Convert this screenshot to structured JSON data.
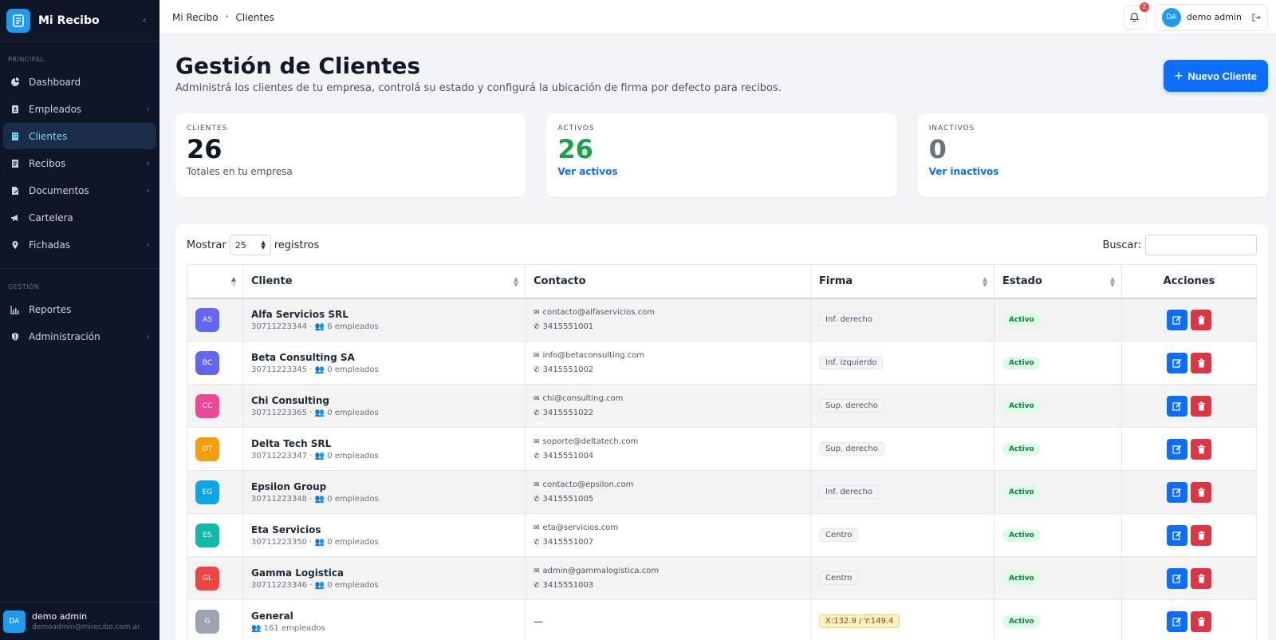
{
  "app": {
    "name": "Mi Recibo"
  },
  "sidebar": {
    "section_principal": "PRINCIPAL",
    "section_gestion": "GESTIÓN",
    "items_principal": [
      {
        "label": "Dashboard",
        "icon": "dashboard-icon"
      },
      {
        "label": "Empleados",
        "icon": "id-card-icon",
        "has_children": true
      },
      {
        "label": "Clientes",
        "icon": "building-icon",
        "active": true
      },
      {
        "label": "Recibos",
        "icon": "receipt-icon",
        "has_children": true
      },
      {
        "label": "Documentos",
        "icon": "document-icon",
        "has_children": true
      },
      {
        "label": "Cartelera",
        "icon": "megaphone-icon"
      },
      {
        "label": "Fichadas",
        "icon": "location-pin-icon",
        "has_children": true
      }
    ],
    "items_gestion": [
      {
        "label": "Reportes",
        "icon": "chart-icon"
      },
      {
        "label": "Administración",
        "icon": "shield-icon",
        "has_children": true
      }
    ],
    "user": {
      "initials": "DA",
      "name": "demo admin",
      "email": "demoadmin@mirecibo.com.ar"
    }
  },
  "topbar": {
    "breadcrumb": [
      "Mi Recibo",
      "Clientes"
    ],
    "notifications_count": "2",
    "user_initials": "DA",
    "user_name": "demo admin"
  },
  "page": {
    "title": "Gestión de Clientes",
    "subtitle": "Administrá los clientes de tu empresa, controlá su estado y configurá la ubicación de firma por defecto para recibos.",
    "new_button": "Nuevo Cliente"
  },
  "stats": {
    "clientes": {
      "label": "CLIENTES",
      "value": "26",
      "note": "Totales en tu empresa"
    },
    "activos": {
      "label": "ACTIVOS",
      "value": "26",
      "link": "Ver activos"
    },
    "inactivos": {
      "label": "INACTIVOS",
      "value": "0",
      "link": "Ver inactivos"
    }
  },
  "table": {
    "show_label": "Mostrar",
    "page_size": "25",
    "records_label": "registros",
    "search_label": "Buscar:",
    "search_value": "",
    "columns": [
      "",
      "Cliente",
      "Contacto",
      "Firma",
      "Estado",
      "Acciones"
    ],
    "rows": [
      {
        "initials": "AS",
        "color": "#6366f1",
        "name": "Alfa Servicios SRL",
        "cuit": "30711223344",
        "employees": "6 empleados",
        "email": "contacto@alfaservicios.com",
        "phone": "3415551001",
        "firma": "Inf. derecho",
        "estado": "Activo"
      },
      {
        "initials": "BC",
        "color": "#6366f1",
        "name": "Beta Consulting SA",
        "cuit": "30711223345",
        "employees": "0 empleados",
        "email": "info@betaconsulting.com",
        "phone": "3415551002",
        "firma": "Inf. izquierdo",
        "estado": "Activo"
      },
      {
        "initials": "CC",
        "color": "#ec4899",
        "name": "Chi Consulting",
        "cuit": "30711223365",
        "employees": "0 empleados",
        "email": "chi@consulting.com",
        "phone": "3415551022",
        "firma": "Sup. derecho",
        "estado": "Activo"
      },
      {
        "initials": "DT",
        "color": "#f59e0b",
        "name": "Delta Tech SRL",
        "cuit": "30711223347",
        "employees": "0 empleados",
        "email": "soporte@deltatech.com",
        "phone": "3415551004",
        "firma": "Sup. derecho",
        "estado": "Activo"
      },
      {
        "initials": "EG",
        "color": "#0ea5e9",
        "name": "Epsilon Group",
        "cuit": "30711223348",
        "employees": "0 empleados",
        "email": "contacto@epsilon.com",
        "phone": "3415551005",
        "firma": "Inf. derecho",
        "estado": "Activo"
      },
      {
        "initials": "ES",
        "color": "#14b8a6",
        "name": "Eta Servicios",
        "cuit": "30711223350",
        "employees": "0 empleados",
        "email": "eta@servicios.com",
        "phone": "3415551007",
        "firma": "Centro",
        "estado": "Activo"
      },
      {
        "initials": "GL",
        "color": "#ef4444",
        "name": "Gamma Logistica",
        "cuit": "30711223346",
        "employees": "0 empleados",
        "email": "admin@gammalogistica.com",
        "phone": "3415551003",
        "firma": "Centro",
        "estado": "Activo"
      },
      {
        "initials": "G",
        "color": "#9ca3af",
        "name": "General",
        "cuit": "",
        "employees": "161 empleados",
        "email": "",
        "phone": "",
        "no_contact": "—",
        "firma": "X:132.9 / Y:149.4",
        "firma_warn": true,
        "estado": "Activo"
      }
    ]
  },
  "colors": {
    "primary": "#0d6efd",
    "danger": "#dc3545",
    "success": "#16a34a",
    "sidebar_bg": "#0e1628"
  }
}
